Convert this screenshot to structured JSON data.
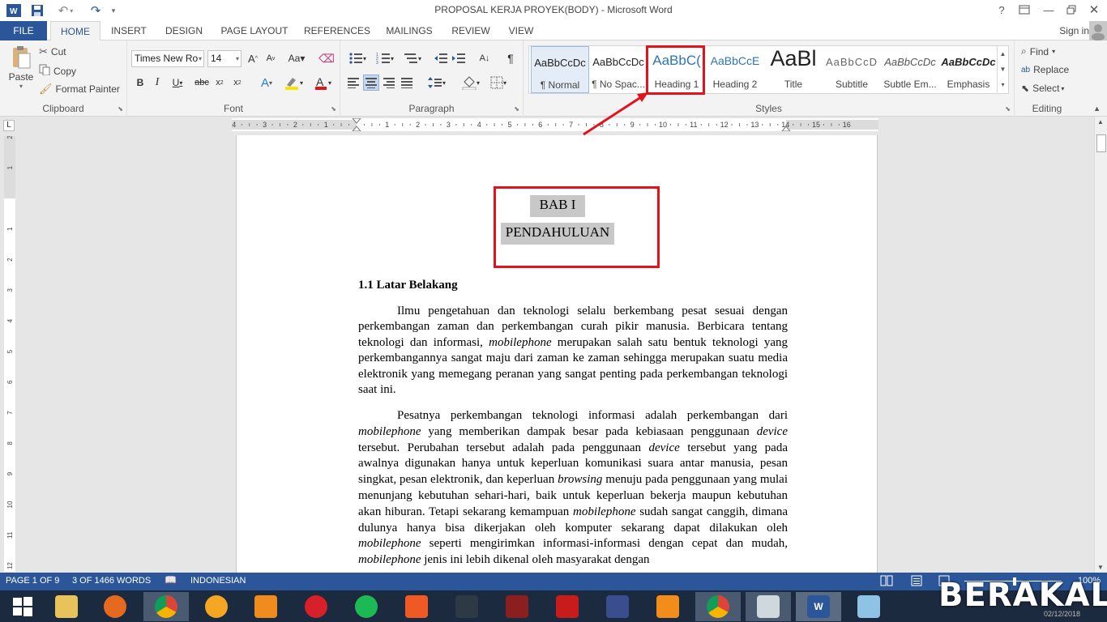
{
  "window": {
    "title": "PROPOSAL KERJA PROYEK(BODY) - Microsoft Word"
  },
  "tabs": [
    "FILE",
    "HOME",
    "INSERT",
    "DESIGN",
    "PAGE LAYOUT",
    "REFERENCES",
    "MAILINGS",
    "REVIEW",
    "VIEW"
  ],
  "account": {
    "signin": "Sign in"
  },
  "clipboard": {
    "paste": "Paste",
    "cut": "Cut",
    "copy": "Copy",
    "format_painter": "Format Painter",
    "label": "Clipboard"
  },
  "font": {
    "name": "Times New Ro",
    "size": "14",
    "label": "Font"
  },
  "paragraph": {
    "label": "Paragraph"
  },
  "styles": {
    "label": "Styles",
    "items": [
      {
        "preview": "AaBbCcDc",
        "name": "¶ Normal"
      },
      {
        "preview": "AaBbCcDc",
        "name": "¶ No Spac..."
      },
      {
        "preview": "AaBbC(",
        "name": "Heading 1"
      },
      {
        "preview": "AaBbCcE",
        "name": "Heading 2"
      },
      {
        "preview": "AaBl",
        "name": "Title"
      },
      {
        "preview": "AaBbCcD",
        "name": "Subtitle"
      },
      {
        "preview": "AaBbCcDc",
        "name": "Subtle Em..."
      },
      {
        "preview": "AaBbCcDc",
        "name": "Emphasis"
      }
    ]
  },
  "editing": {
    "find": "Find",
    "replace": "Replace",
    "select": "Select",
    "label": "Editing"
  },
  "ruler": {
    "h_ticks": [
      "4",
      "3",
      "2",
      "1",
      "1",
      "2",
      "3",
      "4",
      "5",
      "6",
      "7",
      "8",
      "9",
      "10",
      "11",
      "12",
      "13",
      "14",
      "15",
      "16"
    ],
    "v_ticks": [
      "2",
      "1",
      "1",
      "2",
      "3",
      "4",
      "5",
      "6",
      "7",
      "8",
      "9",
      "10",
      "11",
      "12"
    ]
  },
  "document": {
    "heading_line1": "BAB I",
    "heading_line2": "PENDAHULUAN",
    "section_title": "1.1 Latar Belakang",
    "p1": [
      {
        "t": "Ilmu pengetahuan dan teknologi selalu berkembang pesat sesuai dengan perkembangan zaman dan perkembangan curah pikir manusia. Berbicara tentang teknologi dan informasi, "
      },
      {
        "t": "mobilephone",
        "i": true
      },
      {
        "t": " merupakan salah satu bentuk teknologi yang perkembangannya sangat maju dari zaman ke zaman sehingga merupakan suatu media elektronik yang memegang peranan yang sangat penting pada perkembangan teknologi saat ini."
      }
    ],
    "p2": [
      {
        "t": "Pesatnya perkembangan teknologi informasi adalah perkembangan dari "
      },
      {
        "t": "mobilephone",
        "i": true
      },
      {
        "t": " yang memberikan dampak besar pada kebiasaan penggunaan "
      },
      {
        "t": "device",
        "i": true
      },
      {
        "t": " tersebut. Perubahan tersebut adalah pada penggunaan "
      },
      {
        "t": "device",
        "i": true
      },
      {
        "t": " tersebut yang pada awalnya digunakan hanya untuk keperluan komunikasi suara antar manusia, pesan singkat, pesan elektronik, dan keperluan "
      },
      {
        "t": "browsing",
        "i": true
      },
      {
        "t": " menuju pada penggunaan yang mulai menunjang kebutuhan sehari-hari, baik untuk keperluan bekerja maupun kebutuhan akan hiburan. Tetapi sekarang kemampuan "
      },
      {
        "t": "mobilephone",
        "i": true
      },
      {
        "t": " sudah sangat canggih, dimana dulunya hanya bisa dikerjakan oleh komputer sekarang dapat dilakukan oleh "
      },
      {
        "t": "mobilephone",
        "i": true
      },
      {
        "t": " seperti mengirimkan informasi-informasi dengan cepat dan mudah, "
      },
      {
        "t": "mobilephone",
        "i": true
      },
      {
        "t": " jenis ini lebih dikenal oleh masyarakat dengan"
      }
    ]
  },
  "status": {
    "page": "PAGE 1 OF 9",
    "words": "3 OF 1466 WORDS",
    "language": "INDONESIAN",
    "zoom": "100%",
    "date": "02/12/2018"
  },
  "watermark": "BERAKAL",
  "taskbar": [
    "start",
    "file-explorer",
    "firefox",
    "chrome",
    "headphones-app",
    "fl-studio",
    "music-player",
    "spotify",
    "mendeley",
    "nox",
    "game-app",
    "garena",
    "game-launcher",
    "uc-browser",
    "chrome",
    "image-viewer",
    "word",
    "notepad"
  ],
  "colors": {
    "word_blue": "#2b579a",
    "highlight_red": "#e3121b",
    "text_highlight": "#c8c8c8"
  }
}
